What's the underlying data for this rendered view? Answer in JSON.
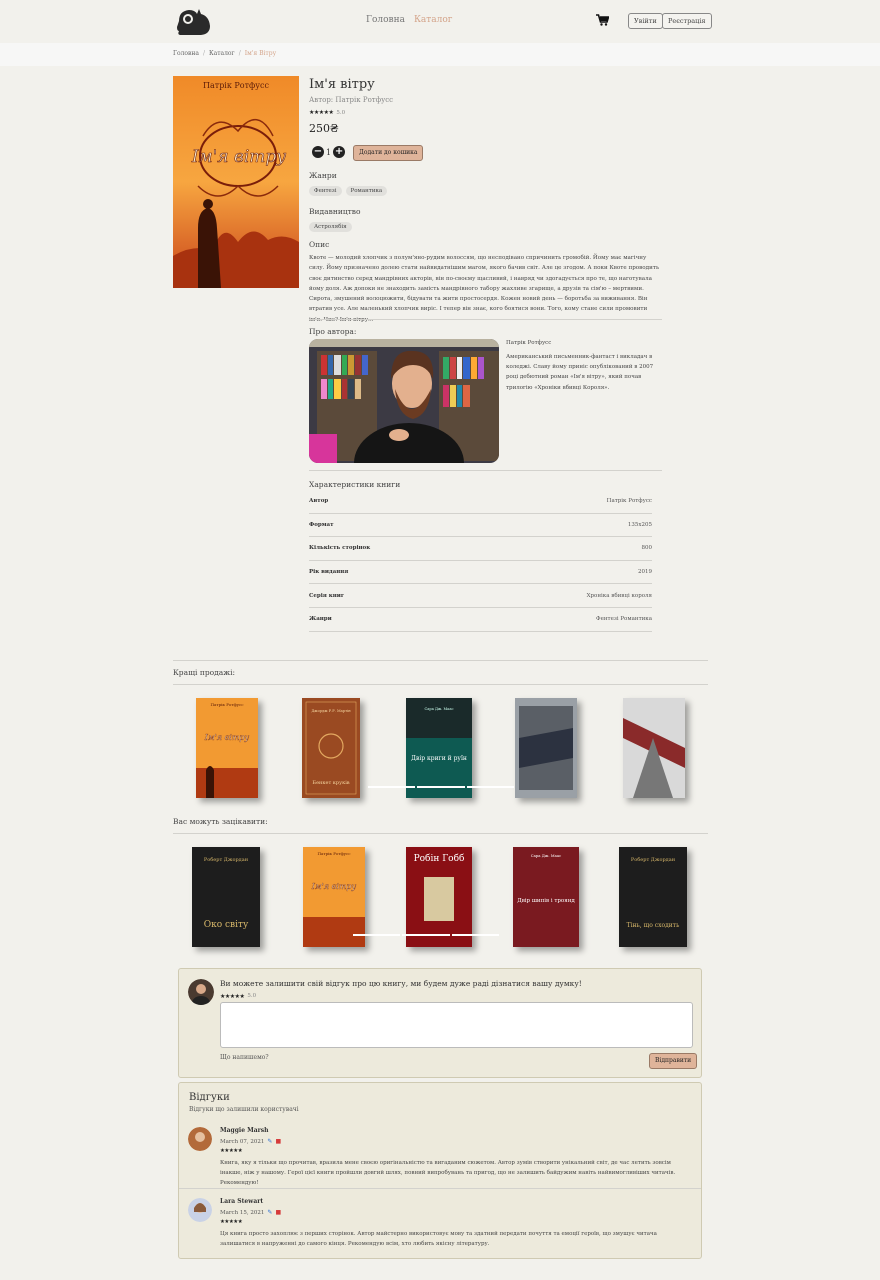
{
  "header": {
    "nav": [
      "Головна",
      "Каталог"
    ],
    "login_label": "Увійти",
    "register_label": "Реєстрація"
  },
  "breadcrumb": [
    "Головна",
    "Каталог",
    "Ім'я Вітру"
  ],
  "product": {
    "cover_title": "Ім'я вітру",
    "cover_author": "Патрік Ротфусс",
    "title": "Ім'я вітру",
    "author": "Автор: Патрік Ротфусс",
    "stars": "★★★★★",
    "rating": "5.0",
    "price": "250₴",
    "qty": "1",
    "add_to_cart": "Додати до кошика",
    "genres_label": "Жанри",
    "genres": [
      "Фентезі",
      "Романтика"
    ],
    "publisher_label": "Видавництво",
    "publisher": "Астролябія",
    "description_label": "Опис",
    "description": "Квоте — молодий хлопчик з полум'яно-рудим волоссям, що несподівано спричинить громобій. Йому має магічну силу. Йому призначено долею стати найвидатнішим магом, якого бачив світ. Але це згодом. А поки Квоте проводить своє дитинство серед мандрівних акторів, він по-своєму щасливий, і навряд чи здогадується про те, що наготувала йому доля. Аж допоки не знаходить замість мандрівного табору жахливе згарище, а друзів та сім'ю – мертвими. Сирота, змушений волоцюжити, бідувати та жити простосердя. Кожен новий день — боротьба за виживання. Він втратив усе. Але маленький хлопчик виріс. І тепер він знає, кого боятися вони. Того, кому стане сили промовити ім'я. Чиє? Ім'я вітру…"
  },
  "about_author": {
    "label": "Про автора:",
    "name": "Патрік Ротфусс",
    "bio": "Американський письменник-фантаст і викладач в коледжі. Славу йому приніс опублікований в 2007 році дебютний роман «Ім'я вітру», який почав трилогію «Хроніки вбивці Короля»."
  },
  "characteristics": {
    "title": "Характеристики книги",
    "rows": [
      {
        "key": "Автор",
        "value": "Патрік Ротфусс"
      },
      {
        "key": "Формат",
        "value": "135х205"
      },
      {
        "key": "Кількість сторінок",
        "value": "800"
      },
      {
        "key": "Рік видання",
        "value": "2019"
      },
      {
        "key": "Серія книг",
        "value": "Хроніка вбивці короля"
      },
      {
        "key": "Жанри",
        "value": "Фентезі Романтика"
      }
    ]
  },
  "bestsellers": {
    "title": "Кращі продажі:",
    "books": [
      {
        "title": "Ім'я вітру",
        "author": "Патрік Ротфусс"
      },
      {
        "title": "Бенкет круків",
        "author": "Джордж Р.Р. Мартін"
      },
      {
        "title": "Двір криги й руїн",
        "author": "Сара Дж. Маас"
      },
      {
        "title": "",
        "author": ""
      },
      {
        "title": "",
        "author": ""
      }
    ]
  },
  "recommended": {
    "title": "Вас можуть зацікавити:",
    "books": [
      {
        "title": "Око світу",
        "author": "Роберт Джордан"
      },
      {
        "title": "Ім'я вітру",
        "author": "Патрік Ротфусс"
      },
      {
        "title": "",
        "author": "Робін Гобб"
      },
      {
        "title": "Двір шипів і троянд",
        "author": "Сара Дж. Маас"
      },
      {
        "title": "Тінь, що сходить",
        "author": "Роберт Джордан"
      }
    ]
  },
  "review_form": {
    "prompt": "Ви можете залишити свій відгук про цю книгу, ми будем дуже раді дізнатися вашу думку!",
    "stars": "★★★★★",
    "rating": "5.0",
    "hint": "Що напишемо?",
    "submit": "Відправити"
  },
  "reviews": {
    "title": "Відгуки",
    "subtitle": "Відгуки що залишили користувачі",
    "items": [
      {
        "name": "Maggie Marsh",
        "date": "March 07, 2021",
        "stars": "★★★★★",
        "text": "Книга, яку я тільки що прочитав, вразила мене своєю оригінальністю та вигаданим сюжетом. Автор зумів створити унікальний світ, де час летить зовсім інакше, ніж у нашому. Герої цієї книги пройшли довгий шлях, повний випробувань та пригод, що не залишить байдужим навіть найвимогливіших читачів. Рекомендую!"
      },
      {
        "name": "Lara Stewart",
        "date": "March 15, 2021",
        "stars": "★★★★★",
        "text": "Ця книга просто захоплює з перших сторінок. Автор майстерно використовує мову та здатний передати почуття та емоції героїв, що змушує читача залишатися в напруженні до самого кінця. Рекомендую всім, хто любить якісну літературу."
      }
    ]
  },
  "colors": {
    "accent": "#d4a48a",
    "button": "#dfb49a",
    "panel": "#edeadc"
  }
}
